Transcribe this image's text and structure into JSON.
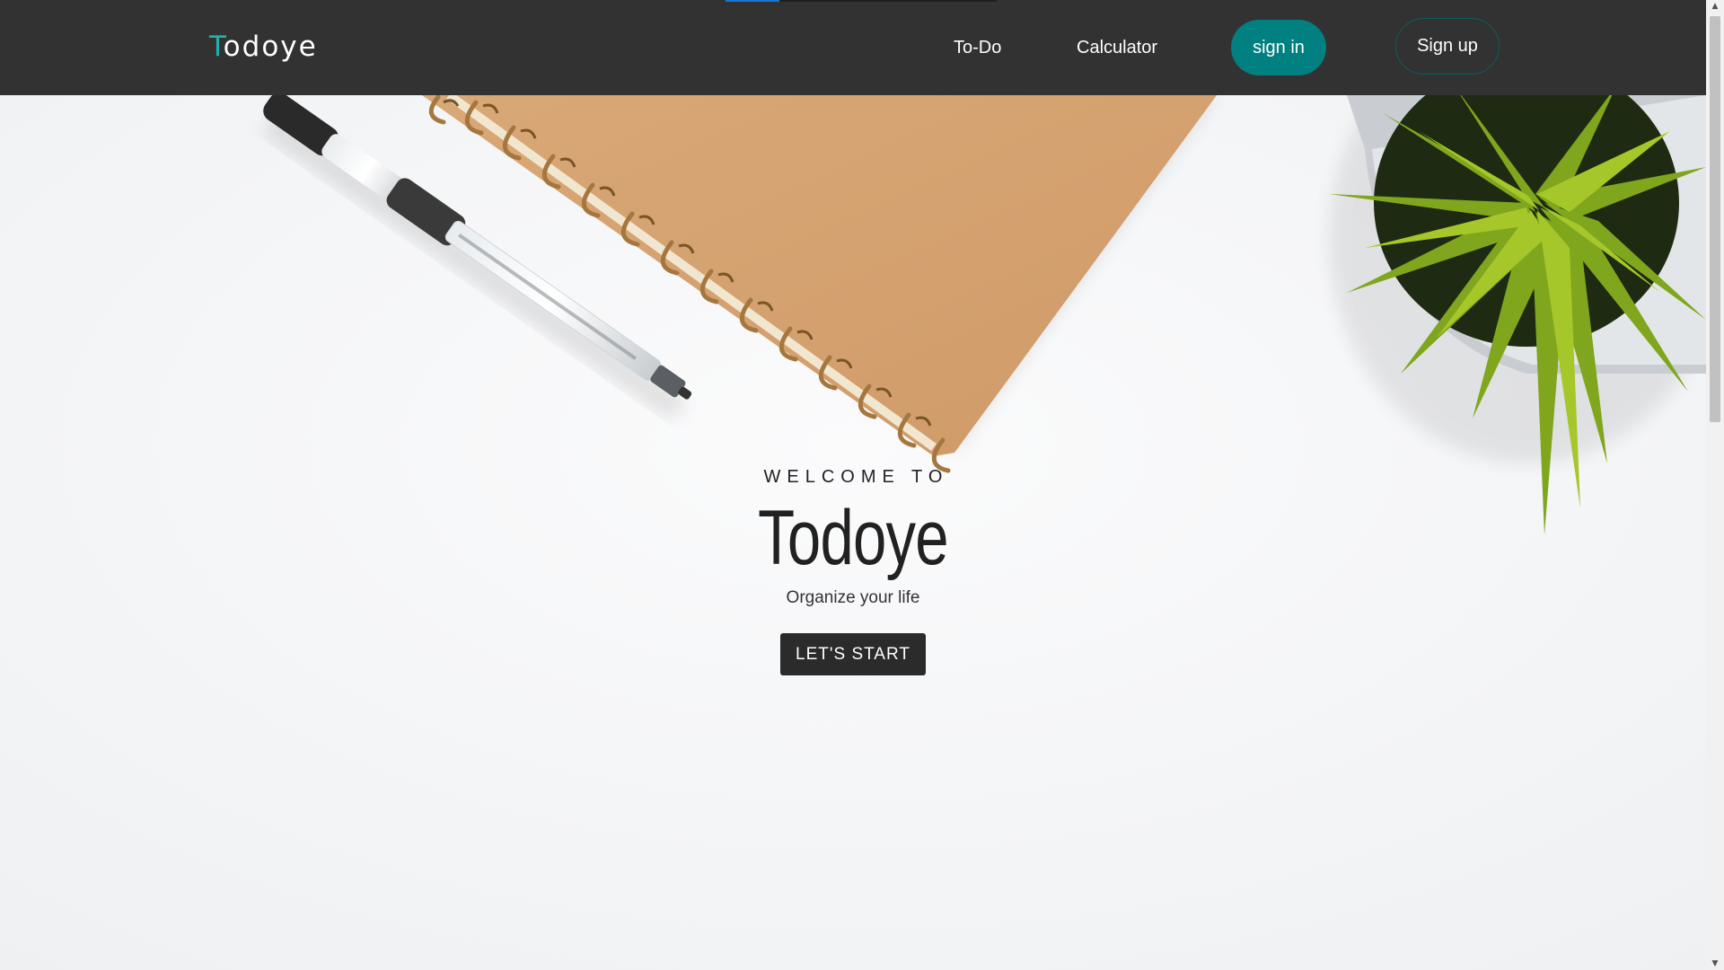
{
  "navbar": {
    "brand_first": "T",
    "brand_rest": "odoye",
    "links": [
      {
        "label": "To-Do"
      },
      {
        "label": "Calculator"
      }
    ],
    "signin_label": "sign in",
    "signup_label": "Sign up",
    "loading_progress": 0.2
  },
  "hero": {
    "welcome": "WELCOME TO",
    "title": "Todoye",
    "tagline": "Organize your life",
    "cta_label": "LET'S START"
  },
  "colors": {
    "navbar_bg": "#323232",
    "accent": "#008080",
    "brand_accent": "#20b2aa",
    "cta_bg": "#2b2b2b",
    "page_bg": "#f7f8f9"
  },
  "icons": [
    "pen-image",
    "notebook-image",
    "plant-image",
    "scroll-up-arrow",
    "scroll-down-arrow"
  ]
}
